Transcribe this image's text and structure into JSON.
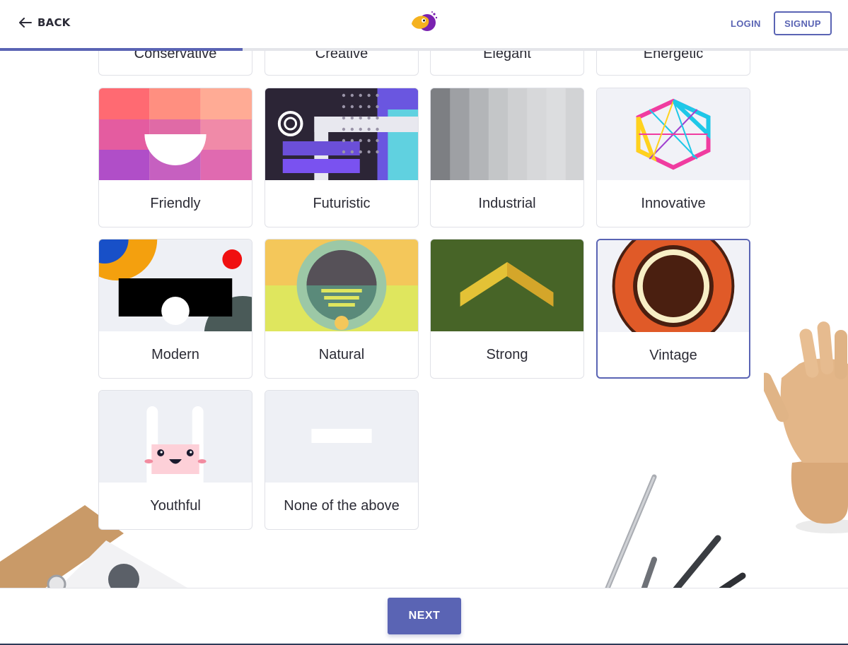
{
  "header": {
    "back_label": "BACK",
    "login_label": "LOGIN",
    "signup_label": "SIGNUP"
  },
  "progress": {
    "fraction": 0.286
  },
  "styles_partial": [
    {
      "label": "Conservative"
    },
    {
      "label": "Creative"
    },
    {
      "label": "Elegant"
    },
    {
      "label": "Energetic"
    }
  ],
  "styles": [
    {
      "label": "Friendly",
      "icon": "friendly-thumbnail"
    },
    {
      "label": "Futuristic",
      "icon": "futuristic-thumbnail"
    },
    {
      "label": "Industrial",
      "icon": "industrial-thumbnail"
    },
    {
      "label": "Innovative",
      "icon": "innovative-thumbnail"
    },
    {
      "label": "Modern",
      "icon": "modern-thumbnail"
    },
    {
      "label": "Natural",
      "icon": "natural-thumbnail"
    },
    {
      "label": "Strong",
      "icon": "strong-thumbnail"
    },
    {
      "label": "Vintage",
      "icon": "vintage-thumbnail",
      "selected": true
    },
    {
      "label": "Youthful",
      "icon": "youthful-thumbnail"
    },
    {
      "label": "None of the above",
      "icon": "none-thumbnail"
    }
  ],
  "footer": {
    "next_label": "NEXT"
  },
  "colors": {
    "accent": "#5a64b4",
    "footer_bar": "#2d3a58"
  }
}
